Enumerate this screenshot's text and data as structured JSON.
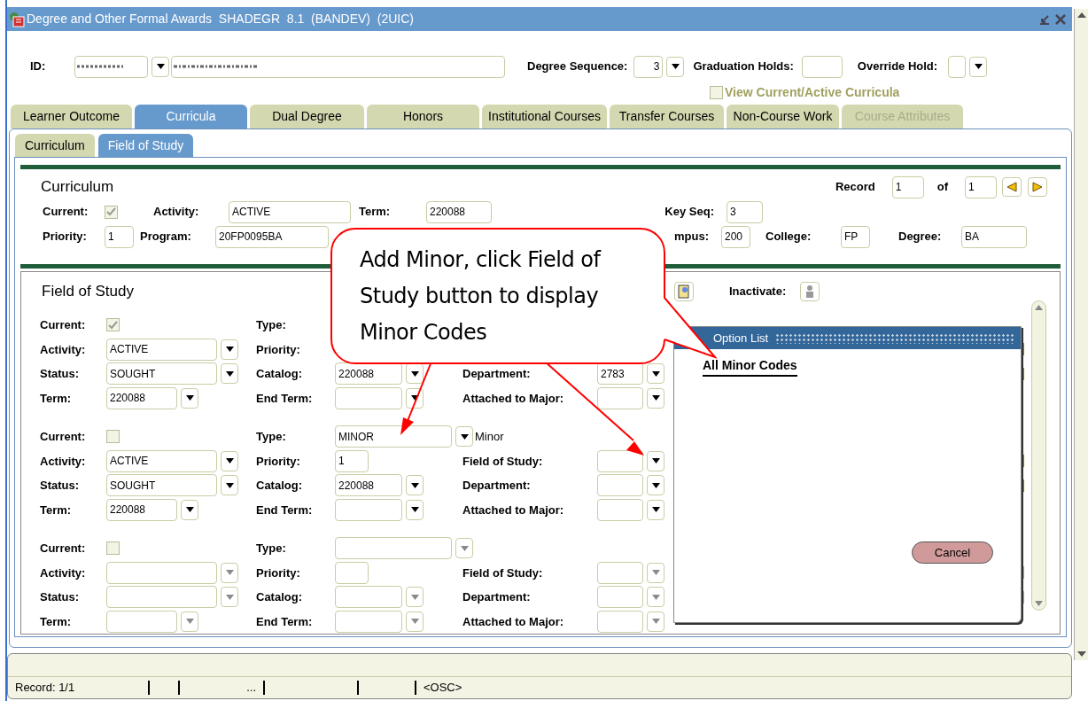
{
  "window": {
    "title": "Degree and Other Formal Awards  SHADEGR  8.1  (BANDEV)  (2UIC)"
  },
  "header": {
    "id_label": "ID:",
    "degree_sequence": {
      "label": "Degree Sequence:",
      "value": "3"
    },
    "graduation_holds": {
      "label": "Graduation Holds:"
    },
    "override_hold": {
      "label": "Override Hold:"
    },
    "view_current": {
      "label": "View Current/Active Curricula",
      "checked": false
    }
  },
  "tabs": [
    {
      "label": "Learner Outcome",
      "selected": false,
      "disabled": false
    },
    {
      "label": "Curricula",
      "selected": true,
      "disabled": false
    },
    {
      "label": "Dual Degree",
      "selected": false,
      "disabled": false
    },
    {
      "label": "Honors",
      "selected": false,
      "disabled": false
    },
    {
      "label": "Institutional Courses",
      "selected": false,
      "disabled": false
    },
    {
      "label": "Transfer Courses",
      "selected": false,
      "disabled": false
    },
    {
      "label": "Non-Course Work",
      "selected": false,
      "disabled": false
    },
    {
      "label": "Course Attributes",
      "selected": false,
      "disabled": true
    }
  ],
  "subtabs": [
    {
      "label": "Curriculum",
      "selected": false
    },
    {
      "label": "Field of Study",
      "selected": true
    }
  ],
  "curriculum": {
    "title": "Curriculum",
    "record": {
      "label": "Record",
      "value": "1",
      "of_label": "of",
      "total": "1"
    },
    "fields": [
      {
        "label": "Current:",
        "kind": "check",
        "checked": true
      },
      {
        "label": "Activity:",
        "kind": "field",
        "value": "ACTIVE"
      },
      {
        "label": "Term:",
        "kind": "field",
        "value": "220088"
      },
      {
        "label": "Key Seq:",
        "kind": "field",
        "value": "3"
      },
      {
        "label": "Priority:",
        "kind": "field",
        "value": "1"
      },
      {
        "label": "Program:",
        "kind": "field",
        "value": "20FP0095BA"
      },
      {
        "label": "mpus:",
        "kind": "field",
        "value": "200"
      },
      {
        "label": "College:",
        "kind": "field",
        "value": "FP"
      },
      {
        "label": "Degree:",
        "kind": "field",
        "value": "BA"
      }
    ]
  },
  "field_of_study": {
    "title": "Field of Study",
    "inactivate_label": "Inactivate:",
    "blocks": [
      {
        "enabled": true,
        "rows": [
          [
            {
              "label": "Current:",
              "kind": "check",
              "checked": true
            },
            {
              "label": "Type:",
              "kind": "label"
            }
          ],
          [
            {
              "label": "Activity:",
              "kind": "field",
              "value": "ACTIVE",
              "dropdown": true
            },
            {
              "label": "Priority:",
              "kind": "label"
            }
          ],
          [
            {
              "label": "Status:",
              "kind": "field",
              "value": "SOUGHT",
              "dropdown": true
            },
            {
              "label": "Catalog:",
              "kind": "field",
              "value": "220088",
              "dropdown": true
            },
            {
              "label": "Department:",
              "kind": "field",
              "value": "2783",
              "dropdown": true
            }
          ],
          [
            {
              "label": "Term:",
              "kind": "field",
              "value": "220088",
              "dropdown": true
            },
            {
              "label": "End Term:",
              "kind": "field",
              "dropdown": true
            },
            {
              "label": "Attached to Major:",
              "kind": "field",
              "dropdown": true
            }
          ]
        ]
      },
      {
        "enabled": true,
        "rows": [
          [
            {
              "label": "Current:",
              "kind": "check",
              "checked": false
            },
            {
              "label": "Type:",
              "kind": "field",
              "value": "MINOR",
              "dropdown": true,
              "desc": "Minor"
            }
          ],
          [
            {
              "label": "Activity:",
              "kind": "field",
              "value": "ACTIVE",
              "dropdown": true
            },
            {
              "label": "Priority:",
              "kind": "field",
              "value": "1",
              "dropdown": false
            },
            {
              "label": "Field of Study:",
              "kind": "field",
              "dropdown": true
            }
          ],
          [
            {
              "label": "Status:",
              "kind": "field",
              "value": "SOUGHT",
              "dropdown": true
            },
            {
              "label": "Catalog:",
              "kind": "field",
              "value": "220088",
              "dropdown": true
            },
            {
              "label": "Department:",
              "kind": "field",
              "dropdown": true
            }
          ],
          [
            {
              "label": "Term:",
              "kind": "field",
              "value": "220088",
              "dropdown": true
            },
            {
              "label": "End Term:",
              "kind": "field",
              "dropdown": true
            },
            {
              "label": "Attached to Major:",
              "kind": "field",
              "dropdown": true
            }
          ]
        ]
      },
      {
        "enabled": false,
        "rows": [
          [
            {
              "label": "Current:",
              "kind": "check",
              "checked": false
            },
            {
              "label": "Type:",
              "kind": "field",
              "dropdown": true
            }
          ],
          [
            {
              "label": "Activity:",
              "kind": "field",
              "dropdown": true
            },
            {
              "label": "Priority:",
              "kind": "field",
              "dropdown": false
            },
            {
              "label": "Field of Study:",
              "kind": "field",
              "dropdown": true
            }
          ],
          [
            {
              "label": "Status:",
              "kind": "field",
              "dropdown": true
            },
            {
              "label": "Catalog:",
              "kind": "field",
              "dropdown": true
            },
            {
              "label": "Department:",
              "kind": "field",
              "dropdown": true
            }
          ],
          [
            {
              "label": "Term:",
              "kind": "field",
              "dropdown": true
            },
            {
              "label": "End Term:",
              "kind": "field",
              "dropdown": true
            },
            {
              "label": "Attached to Major:",
              "kind": "field",
              "dropdown": true
            }
          ]
        ]
      }
    ]
  },
  "option_list": {
    "title": "Option List",
    "items": [
      "All Minor Codes"
    ],
    "cancel": "Cancel"
  },
  "callout": {
    "text": "Add Minor, click Field of Study button to display Minor Codes"
  },
  "status_bar": {
    "record": "Record: 1/1",
    "ellipsis": "...",
    "mode": "<OSC>"
  }
}
